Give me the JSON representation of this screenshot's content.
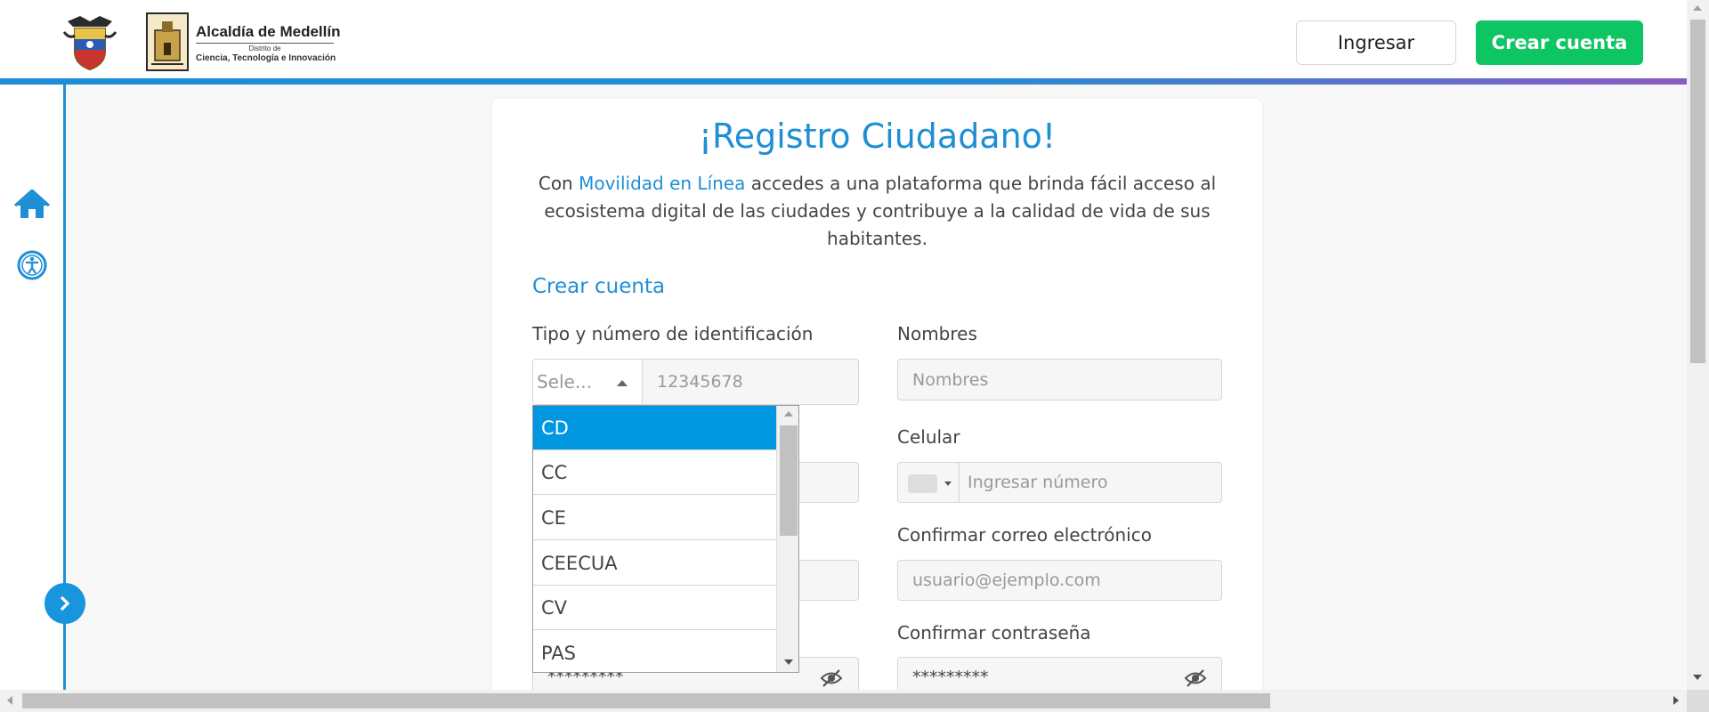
{
  "header": {
    "brand_title": "Alcaldía de Medellín",
    "brand_sub": "Distrito de",
    "brand_sub2": "Ciencia, Tecnología e Innovación",
    "login_label": "Ingresar",
    "signup_label": "Crear cuenta"
  },
  "sidebar": {
    "icons": [
      "home-icon",
      "accessibility-icon",
      "chevron-right-icon"
    ]
  },
  "card": {
    "title": "¡Registro Ciudadano!",
    "desc_pre": "Con ",
    "desc_link": "Movilidad en Línea",
    "desc_post": " accedes a una plataforma que brinda fácil acceso al ecosistema digital de las ciudades y contribuye a la calidad de vida de sus habitantes.",
    "section": "Crear cuenta"
  },
  "form": {
    "id_label": "Tipo y número de identificación",
    "id_type_value": "Sele...",
    "id_number_placeholder": "12345678",
    "names_label": "Nombres",
    "names_placeholder": "Nombres",
    "phone_label": "Celular",
    "phone_placeholder": "Ingresar número",
    "confirm_email_label": "Confirmar correo electrónico",
    "confirm_email_placeholder": "usuario@ejemplo.com",
    "confirm_password_label": "Confirmar contraseña",
    "password_mask": "*********"
  },
  "dropdown": {
    "options": [
      "CD",
      "CC",
      "CE",
      "CEECUA",
      "CV",
      "PAS"
    ],
    "selected": "CD"
  },
  "colors": {
    "primary": "#1f8fd4",
    "success": "#0ec563",
    "selected_option": "#0097e0"
  }
}
